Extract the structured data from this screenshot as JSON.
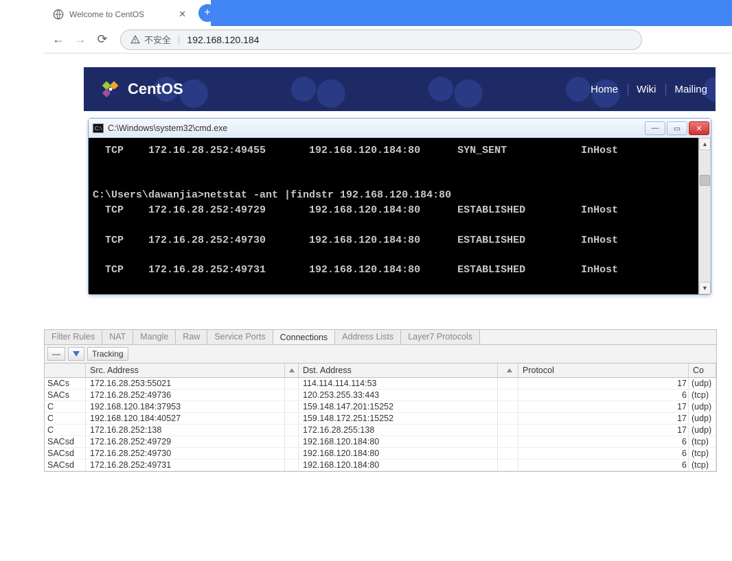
{
  "browser": {
    "tab_title": "Welcome to CentOS",
    "security_label": "不安全",
    "url": "192.168.120.184"
  },
  "centos": {
    "brand": "CentOS",
    "links": [
      "Home",
      "Wiki",
      "Mailing"
    ]
  },
  "cmd": {
    "title": "C:\\Windows\\system32\\cmd.exe",
    "prompt": "C:\\Users\\dawanjia>netstat -ant |findstr 192.168.120.184:80",
    "rows": [
      {
        "proto": "TCP",
        "local": "172.16.28.252:49455",
        "remote": "192.168.120.184:80",
        "state": "SYN_SENT",
        "host": "InHost"
      },
      {
        "proto": "TCP",
        "local": "172.16.28.252:49729",
        "remote": "192.168.120.184:80",
        "state": "ESTABLISHED",
        "host": "InHost"
      },
      {
        "proto": "TCP",
        "local": "172.16.28.252:49730",
        "remote": "192.168.120.184:80",
        "state": "ESTABLISHED",
        "host": "InHost"
      },
      {
        "proto": "TCP",
        "local": "172.16.28.252:49731",
        "remote": "192.168.120.184:80",
        "state": "ESTABLISHED",
        "host": "InHost"
      }
    ]
  },
  "router": {
    "tabs": [
      "Filter Rules",
      "NAT",
      "Mangle",
      "Raw",
      "Service Ports",
      "Connections",
      "Address Lists",
      "Layer7 Protocols"
    ],
    "active_tab": 5,
    "tracking": "Tracking",
    "columns": {
      "src": "Src. Address",
      "dst": "Dst. Address",
      "proto": "Protocol",
      "co": "Co"
    },
    "rows": [
      {
        "flag": "SACs",
        "src": "172.16.28.253:55021",
        "dst": "114.114.114.114:53",
        "pnum": "17",
        "pname": "(udp)"
      },
      {
        "flag": "SACs",
        "src": "172.16.28.252:49736",
        "dst": "120.253.255.33:443",
        "pnum": "6",
        "pname": "(tcp)"
      },
      {
        "flag": "C",
        "src": "192.168.120.184:37953",
        "dst": "159.148.147.201:15252",
        "pnum": "17",
        "pname": "(udp)"
      },
      {
        "flag": "C",
        "src": "192.168.120.184:40527",
        "dst": "159.148.172.251:15252",
        "pnum": "17",
        "pname": "(udp)"
      },
      {
        "flag": "C",
        "src": "172.16.28.252:138",
        "dst": "172.16.28.255:138",
        "pnum": "17",
        "pname": "(udp)"
      },
      {
        "flag": "SACsd",
        "src": "172.16.28.252:49729",
        "dst": "192.168.120.184:80",
        "pnum": "6",
        "pname": "(tcp)"
      },
      {
        "flag": "SACsd",
        "src": "172.16.28.252:49730",
        "dst": "192.168.120.184:80",
        "pnum": "6",
        "pname": "(tcp)"
      },
      {
        "flag": "SACsd",
        "src": "172.16.28.252:49731",
        "dst": "192.168.120.184:80",
        "pnum": "6",
        "pname": "(tcp)"
      }
    ]
  }
}
